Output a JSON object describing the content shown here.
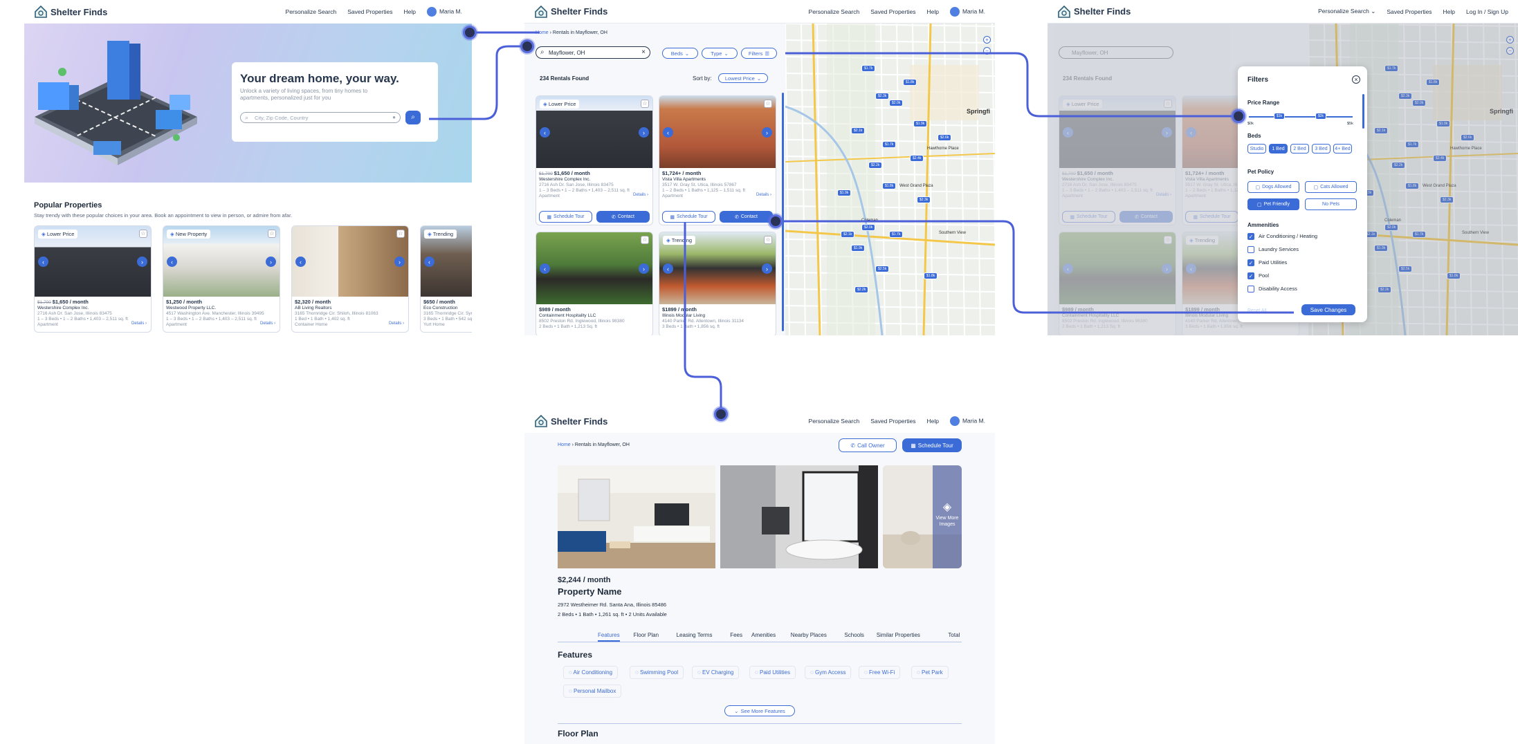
{
  "brand": "Shelter Finds",
  "nav": {
    "personalize": "Personalize Search",
    "saved": "Saved Properties",
    "help": "Help",
    "user": "Maria M.",
    "login": "Log In / Sign Up"
  },
  "home": {
    "hero_title": "Your dream home, your way.",
    "hero_sub": "Unlock a variety of living spaces, from tiny homes to apartments, personalized just for you",
    "search_placeholder": "City, Zip Code, Country",
    "popular_title": "Popular Properties",
    "popular_sub": "Stay trendy with these popular choices in your area. Book an appointment to view in person, or admire from afar.",
    "cards": [
      {
        "tag": "Lower Price",
        "old": "$1,700",
        "price": "$1,650 / month",
        "company": "Westershire Complex Inc.",
        "address": "2716 Ash Dr. San Jose, Illinois 83475",
        "specs": "1 – 3 Beds • 1 – 2 Baths • 1,403 – 2,511 sq. ft",
        "type": "Apartment",
        "details": "Details"
      },
      {
        "tag": "New Property",
        "old": "",
        "price": "$1,250 / month",
        "company": "Westwood Property LLC.",
        "address": "4517 Washington Ave. Manchester, Illinois 39495",
        "specs": "1 – 3 Beds • 1 – 2 Baths • 1,403 – 2,511 sq. ft",
        "type": "Apartment",
        "details": "Details"
      },
      {
        "tag": "",
        "old": "",
        "price": "$2,320 / month",
        "company": "AB Living Realtors",
        "address": "3165 Thornridge Cir. Shiloh, Illinois 81063",
        "specs": "1 Bed • 1 Bath • 1,402 sq. ft",
        "type": "Container Home",
        "details": "Details"
      },
      {
        "tag": "Trending",
        "old": "",
        "price": "$650 / month",
        "company": "Eco Construction",
        "address": "3165 Thornridge Cir. Syrac",
        "specs": "3 Beds • 1 Bath • 542 sq. ft",
        "type": "Yurt Home",
        "details": ""
      }
    ]
  },
  "results": {
    "breadcrumb_home": "Home",
    "breadcrumb_current": "Rentals in Mayflower, OH",
    "search_value": "Mayflower, OH",
    "beds": "Beds",
    "type": "Type",
    "filters": "Filters",
    "count": "234 Rentals Found",
    "sort_label": "Sort by:",
    "sort_value": "Lowest Price",
    "cards": [
      {
        "tag": "Lower Price",
        "old": "$1,700",
        "price": "$1,650 / month",
        "company": "Westershire Complex Inc.",
        "address": "2716 Ash Dr. San Jose, Illinois 83475",
        "specs": "1 – 3 Beds • 1 – 2 Baths • 1,403 – 2,511 sq. ft",
        "type": "Apartment",
        "details": "Details"
      },
      {
        "tag": "",
        "old": "",
        "price": "$1,724+ / month",
        "company": "Vista Villa Apartments",
        "address": "3517 W. Gray St. Utica, Illinois 57867",
        "specs": "1 – 2 Beds • 1 Baths • 1,125 – 1,511 sq. ft",
        "type": "Apartment",
        "details": "Details"
      },
      {
        "tag": "",
        "old": "",
        "price": "$989 / month",
        "company": "Containment Hospitality LLC",
        "address": "8502 Preston Rd. Inglewood, Illinois 98380",
        "specs": "2 Beds • 1 Bath • 1,213 Sq. ft",
        "type": "",
        "details": ""
      },
      {
        "tag": "Trending",
        "old": "",
        "price": "$1899 / month",
        "company": "Illinois Modular Living",
        "address": "4140 Parker Rd. Allentown, Illinois 31134",
        "specs": "3 Beds • 1 Bath • 1,856 sq. ft",
        "type": "",
        "details": ""
      }
    ],
    "schedule": "Schedule Tour",
    "contact": "Contact",
    "map_labels": [
      "Springfi",
      "Hawthorne Place",
      "West Grand Plaza",
      "Coleman",
      "Southern View"
    ],
    "pins": [
      "$1.7k",
      "$1.8k",
      "$2.3k",
      "$2.0k",
      "$1.9k",
      "$2.1k",
      "$1.7k",
      "$2.4k",
      "$2.6k",
      "$2.2k",
      "$1.9k",
      "$1.8k",
      "$2.3k",
      "$2.0k",
      "$2.1k",
      "$1.7k",
      "$1.9k",
      "$2.5k",
      "$1.8k",
      "$2.2k"
    ]
  },
  "filters": {
    "title": "Filters",
    "price_range": "Price Range",
    "price_pins": [
      "$1k",
      "$2k"
    ],
    "price_min": "$0k",
    "price_max": "$5k",
    "beds_title": "Beds",
    "beds": [
      "Studio",
      "1 Bed",
      "2 Bed",
      "3 Bed",
      "4+ Bed"
    ],
    "pet_title": "Pet Policy",
    "pets": [
      "Dogs Allowed",
      "Cats Allowed",
      "Pet Friendly",
      "No Pets"
    ],
    "amen_title": "Ammenities",
    "amenities": [
      {
        "label": "Air Conditioning / Heating",
        "on": true
      },
      {
        "label": "Laundry Services",
        "on": false
      },
      {
        "label": "Paid Utilities",
        "on": true
      },
      {
        "label": "Pool",
        "on": true
      },
      {
        "label": "Disability Access",
        "on": false
      }
    ],
    "reset": "Reset All",
    "save": "Save Changes"
  },
  "detail": {
    "breadcrumb_home": "Home",
    "breadcrumb_current": "Rentals in Mayflower, OH",
    "call": "Call Owner",
    "schedule": "Schedule Tour",
    "view_more": "View More Images",
    "price": "$2,244 / month",
    "name": "Property Name",
    "address": "2972 Westheimer Rd. Santa Ana, Illinois 85486",
    "specs": "2 Beds • 1 Bath • 1,261 sq. ft • 2 Units Available",
    "tabs": [
      "Features",
      "Floor Plan",
      "Leasing Terms",
      "Fees",
      "Amenities",
      "Nearby Places",
      "Schools",
      "Similar Properties",
      "Total"
    ],
    "features_title": "Features",
    "features": [
      "Air Conditioning",
      "Swimming Pool",
      "EV Charging",
      "Paid Utilities",
      "Gym Access",
      "Free Wi-Fi",
      "Pet Park",
      "Personal Mailbox"
    ],
    "see_more": "See More Features",
    "floor_title": "Floor Plan"
  },
  "colors": {
    "accent": "#3b6bd6",
    "connector": "#4b5fd8",
    "text": "#26364d"
  }
}
